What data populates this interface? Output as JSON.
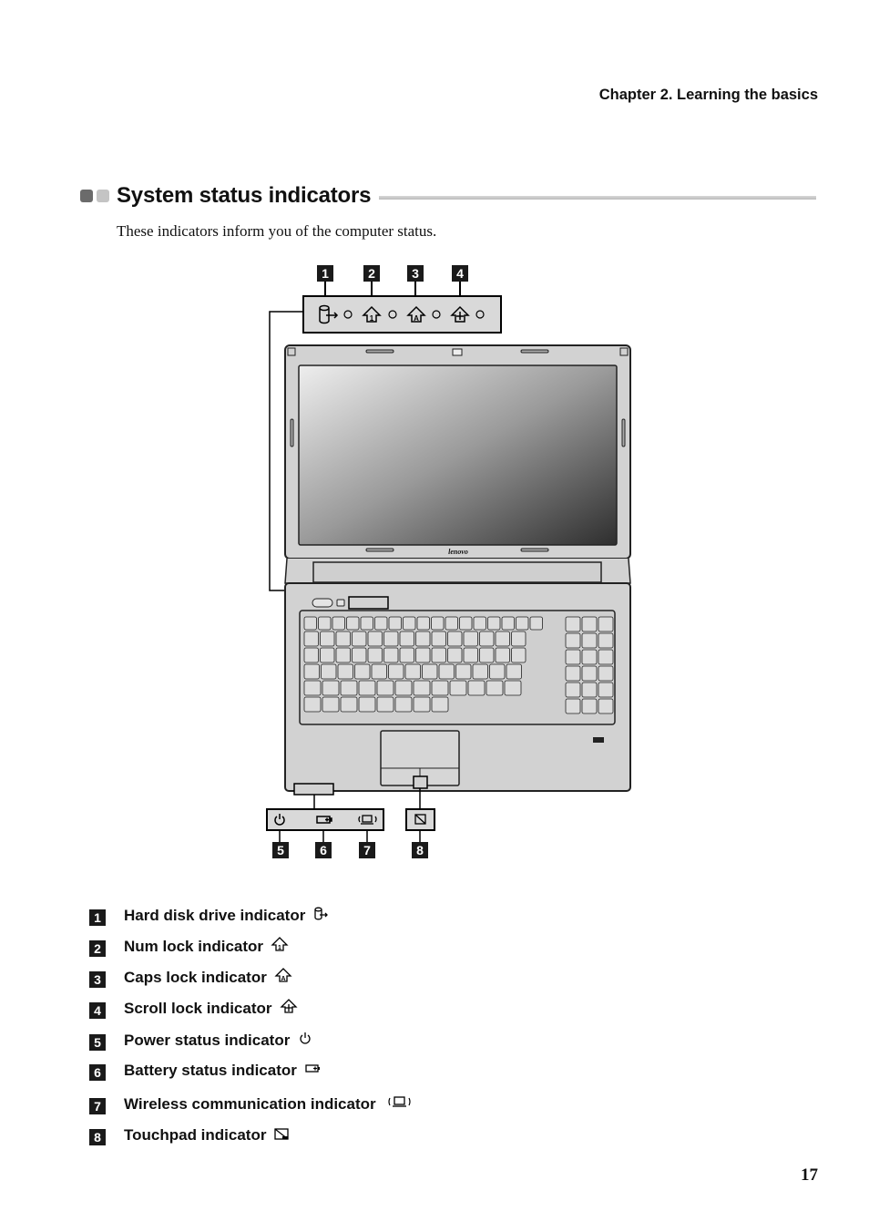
{
  "header": {
    "chapter": "Chapter 2. Learning the basics"
  },
  "section": {
    "title": "System status indicators",
    "intro": "These indicators inform you of the computer status.",
    "colors": {
      "dot_dark": "#6b6b6b",
      "dot_light": "#c4c4c4",
      "panel_fill": "#d9d9d9"
    }
  },
  "figure": {
    "top_callouts": [
      "1",
      "2",
      "3",
      "4"
    ],
    "bottom_callouts": [
      "5",
      "6",
      "7",
      "8"
    ],
    "brand_logo": "lenovo",
    "top_panel_icons": [
      "hard-disk-icon",
      "num-lock-icon",
      "caps-lock-icon",
      "scroll-lock-icon"
    ],
    "bottom_panel_icons": [
      "power-icon",
      "battery-icon",
      "wireless-icon",
      "touchpad-icon"
    ]
  },
  "legend": [
    {
      "num": "1",
      "label": "Hard disk drive indicator",
      "icon": "hard-disk-icon"
    },
    {
      "num": "2",
      "label": "Num lock indicator",
      "icon": "num-lock-icon"
    },
    {
      "num": "3",
      "label": "Caps lock indicator",
      "icon": "caps-lock-icon"
    },
    {
      "num": "4",
      "label": "Scroll lock indicator",
      "icon": "scroll-lock-icon"
    },
    {
      "num": "5",
      "label": "Power status indicator",
      "icon": "power-icon"
    },
    {
      "num": "6",
      "label": "Battery status indicator",
      "icon": "battery-icon"
    },
    {
      "num": "7",
      "label": "Wireless communication indicator",
      "icon": "wireless-icon"
    },
    {
      "num": "8",
      "label": "Touchpad indicator",
      "icon": "touchpad-icon"
    }
  ],
  "footer": {
    "page_number": "17"
  }
}
